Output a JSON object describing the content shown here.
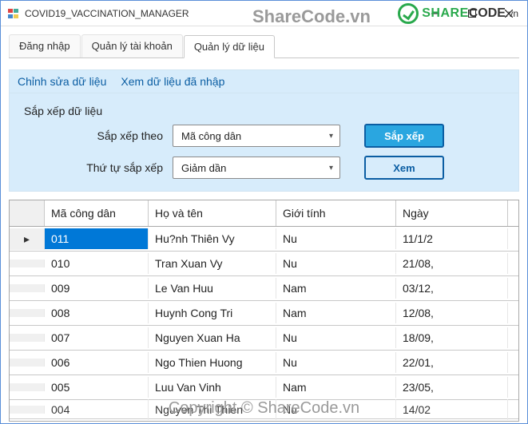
{
  "window": {
    "title": "COVID19_VACCINATION_MANAGER"
  },
  "tabs": {
    "items": [
      {
        "label": "Đăng nhập"
      },
      {
        "label": "Quản lý tài khoản"
      },
      {
        "label": "Quản lý dữ liệu"
      }
    ],
    "active_index": 2
  },
  "subtabs": {
    "items": [
      {
        "label": "Chỉnh sửa dữ liệu"
      },
      {
        "label": "Xem dữ liệu đã nhập"
      }
    ]
  },
  "section": {
    "title": "Sắp xếp dữ liệu",
    "sort_by_label": "Sắp xếp theo",
    "sort_by_value": "Mã công dân",
    "order_label": "Thứ tự sắp xếp",
    "order_value": "Giảm dần",
    "sort_button": "Sắp xếp",
    "view_button": "Xem"
  },
  "grid": {
    "columns": [
      "Mã công dân",
      "Họ và tên",
      "Giới tính",
      "Ngày"
    ],
    "rows": [
      {
        "id": "011",
        "name": "Hu?nh Thiên Vy",
        "gender": "Nu",
        "date": "11/1/2"
      },
      {
        "id": "010",
        "name": "Tran Xuan Vy",
        "gender": "Nu",
        "date": "21/08,"
      },
      {
        "id": "009",
        "name": "Le Van Huu",
        "gender": "Nam",
        "date": "03/12,"
      },
      {
        "id": "008",
        "name": "Huynh Cong Tri",
        "gender": "Nam",
        "date": "12/08,"
      },
      {
        "id": "007",
        "name": "Nguyen Xuan Ha",
        "gender": "Nu",
        "date": "18/09,"
      },
      {
        "id": "006",
        "name": "Ngo Thien Huong",
        "gender": "Nu",
        "date": "22/01,"
      },
      {
        "id": "005",
        "name": "Luu Van Vinh",
        "gender": "Nam",
        "date": "23/05,"
      },
      {
        "id": "004",
        "name": "Nguyen Thi Thien",
        "gender": "Nu",
        "date": "14/02"
      }
    ],
    "selected_index": 0
  },
  "watermark": {
    "top_text": "ShareCode.vn",
    "logo_share": "SHARE",
    "logo_code": "CODE",
    "logo_vn": ".vn",
    "bottom_text": "Copyright © ShareCode.vn"
  }
}
